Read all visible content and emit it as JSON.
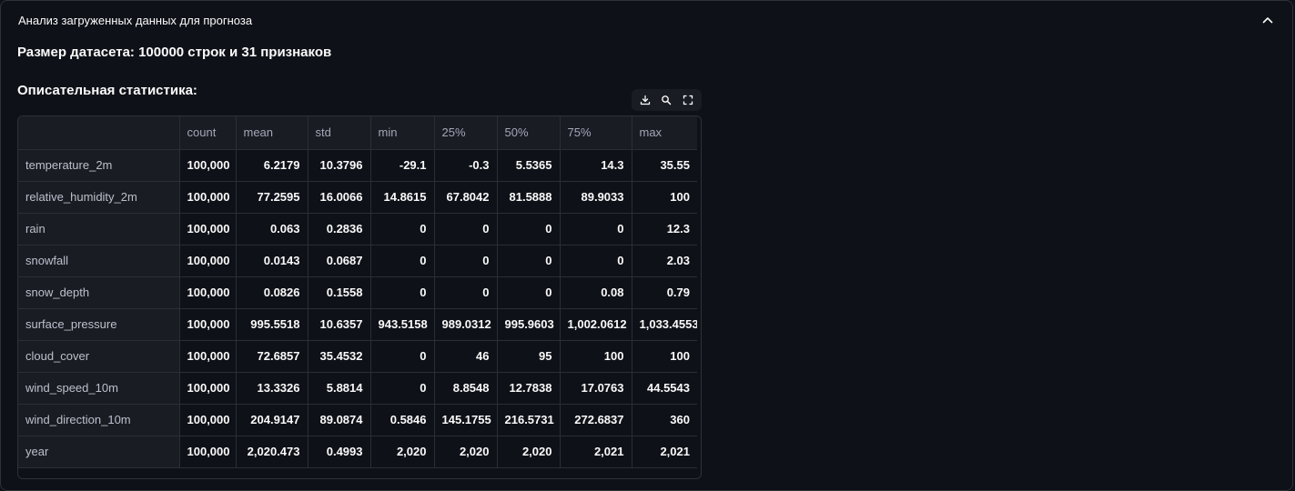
{
  "expander": {
    "title": "Анализ загруженных данных для прогноза",
    "toggle_icon": "chevron-up-icon"
  },
  "dataset_size": "Размер датасета: 100000 строк и 31 признаков",
  "stats_heading": "Описательная статистика:",
  "toolbar": {
    "icons": [
      "download-icon",
      "search-icon",
      "fullscreen-icon"
    ]
  },
  "colors": {
    "background": "#0e1117",
    "header_bg": "#1a1c23",
    "border": "#2e3138",
    "text": "#fafafa",
    "header_text": "#a3a8b8"
  },
  "table": {
    "columns": [
      "",
      "count",
      "mean",
      "std",
      "min",
      "25%",
      "50%",
      "75%",
      "max"
    ],
    "rows": [
      {
        "name": "temperature_2m",
        "values": [
          "100,000",
          "6.2179",
          "10.3796",
          "-29.1",
          "-0.3",
          "5.5365",
          "14.3",
          "35.55"
        ]
      },
      {
        "name": "relative_humidity_2m",
        "values": [
          "100,000",
          "77.2595",
          "16.0066",
          "14.8615",
          "67.8042",
          "81.5888",
          "89.9033",
          "100"
        ]
      },
      {
        "name": "rain",
        "values": [
          "100,000",
          "0.063",
          "0.2836",
          "0",
          "0",
          "0",
          "0",
          "12.3"
        ]
      },
      {
        "name": "snowfall",
        "values": [
          "100,000",
          "0.0143",
          "0.0687",
          "0",
          "0",
          "0",
          "0",
          "2.03"
        ]
      },
      {
        "name": "snow_depth",
        "values": [
          "100,000",
          "0.0826",
          "0.1558",
          "0",
          "0",
          "0",
          "0.08",
          "0.79"
        ]
      },
      {
        "name": "surface_pressure",
        "values": [
          "100,000",
          "995.5518",
          "10.6357",
          "943.5158",
          "989.0312",
          "995.9603",
          "1,002.0612",
          "1,033.4553"
        ]
      },
      {
        "name": "cloud_cover",
        "values": [
          "100,000",
          "72.6857",
          "35.4532",
          "0",
          "46",
          "95",
          "100",
          "100"
        ]
      },
      {
        "name": "wind_speed_10m",
        "values": [
          "100,000",
          "13.3326",
          "5.8814",
          "0",
          "8.8548",
          "12.7838",
          "17.0763",
          "44.5543"
        ]
      },
      {
        "name": "wind_direction_10m",
        "values": [
          "100,000",
          "204.9147",
          "89.0874",
          "0.5846",
          "145.1755",
          "216.5731",
          "272.6837",
          "360"
        ]
      },
      {
        "name": "year",
        "values": [
          "100,000",
          "2,020.473",
          "0.4993",
          "2,020",
          "2,020",
          "2,020",
          "2,021",
          "2,021"
        ]
      }
    ]
  }
}
